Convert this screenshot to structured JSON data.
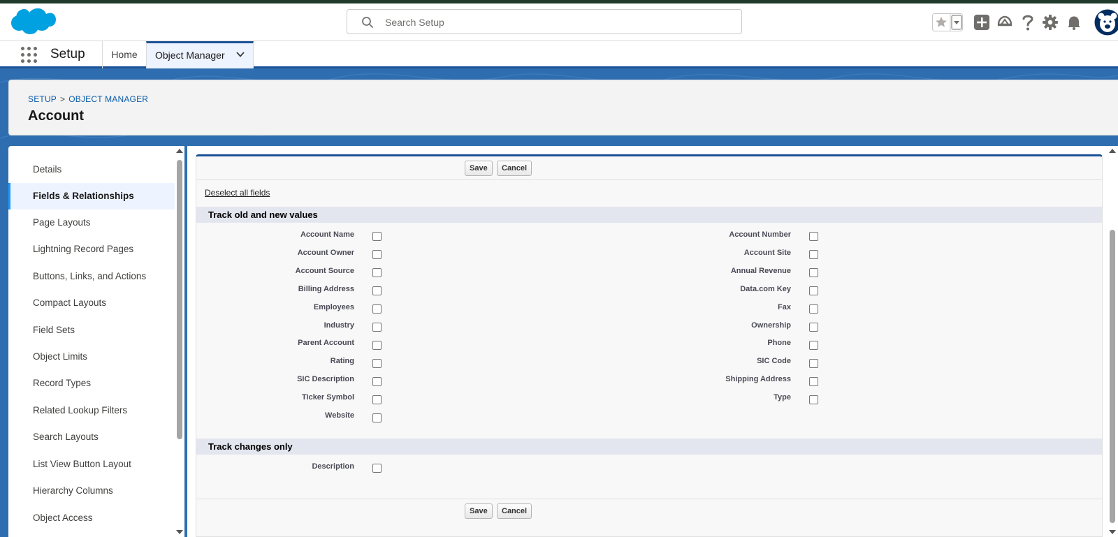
{
  "header": {
    "logo": "salesforce-cloud-logo",
    "search_placeholder": "Search Setup",
    "icons": [
      "favorites-star-icon",
      "favorites-dropdown-icon",
      "global-actions-plus-icon",
      "trailhead-icon",
      "help-icon",
      "setup-gear-icon",
      "notifications-bell-icon",
      "user-avatar"
    ]
  },
  "nav": {
    "app_name": "Setup",
    "tabs": [
      {
        "label": "Home"
      },
      {
        "label": "Object Manager"
      }
    ]
  },
  "page_header": {
    "breadcrumb": [
      "SETUP",
      "OBJECT MANAGER"
    ],
    "breadcrumb_separator": ">",
    "title": "Account"
  },
  "sidebar": {
    "items": [
      {
        "label": "Details"
      },
      {
        "label": "Fields & Relationships",
        "active": true
      },
      {
        "label": "Page Layouts"
      },
      {
        "label": "Lightning Record Pages"
      },
      {
        "label": "Buttons, Links, and Actions"
      },
      {
        "label": "Compact Layouts"
      },
      {
        "label": "Field Sets"
      },
      {
        "label": "Object Limits"
      },
      {
        "label": "Record Types"
      },
      {
        "label": "Related Lookup Filters"
      },
      {
        "label": "Search Layouts"
      },
      {
        "label": "List View Button Layout"
      },
      {
        "label": "Hierarchy Columns"
      },
      {
        "label": "Object Access"
      }
    ]
  },
  "form": {
    "save_label": "Save",
    "cancel_label": "Cancel",
    "deselect_label": "Deselect all fields",
    "section1": {
      "title": "Track old and new values",
      "left_fields": [
        "Account Name",
        "Account Owner",
        "Account Source",
        "Billing Address",
        "Employees",
        "Industry",
        "Parent Account",
        "Rating",
        "SIC Description",
        "Ticker Symbol",
        "Website"
      ],
      "right_fields": [
        "Account Number",
        "Account Site",
        "Annual Revenue",
        "Data.com Key",
        "Fax",
        "Ownership",
        "Phone",
        "SIC Code",
        "Shipping Address",
        "Type"
      ]
    },
    "section2": {
      "title": "Track changes only",
      "fields": [
        "Description"
      ]
    }
  },
  "colors": {
    "brand_blue": "#1b5297",
    "link_blue": "#0b5cab",
    "active_accent": "#1b96ff",
    "background_blue": "#2e6eb0"
  }
}
